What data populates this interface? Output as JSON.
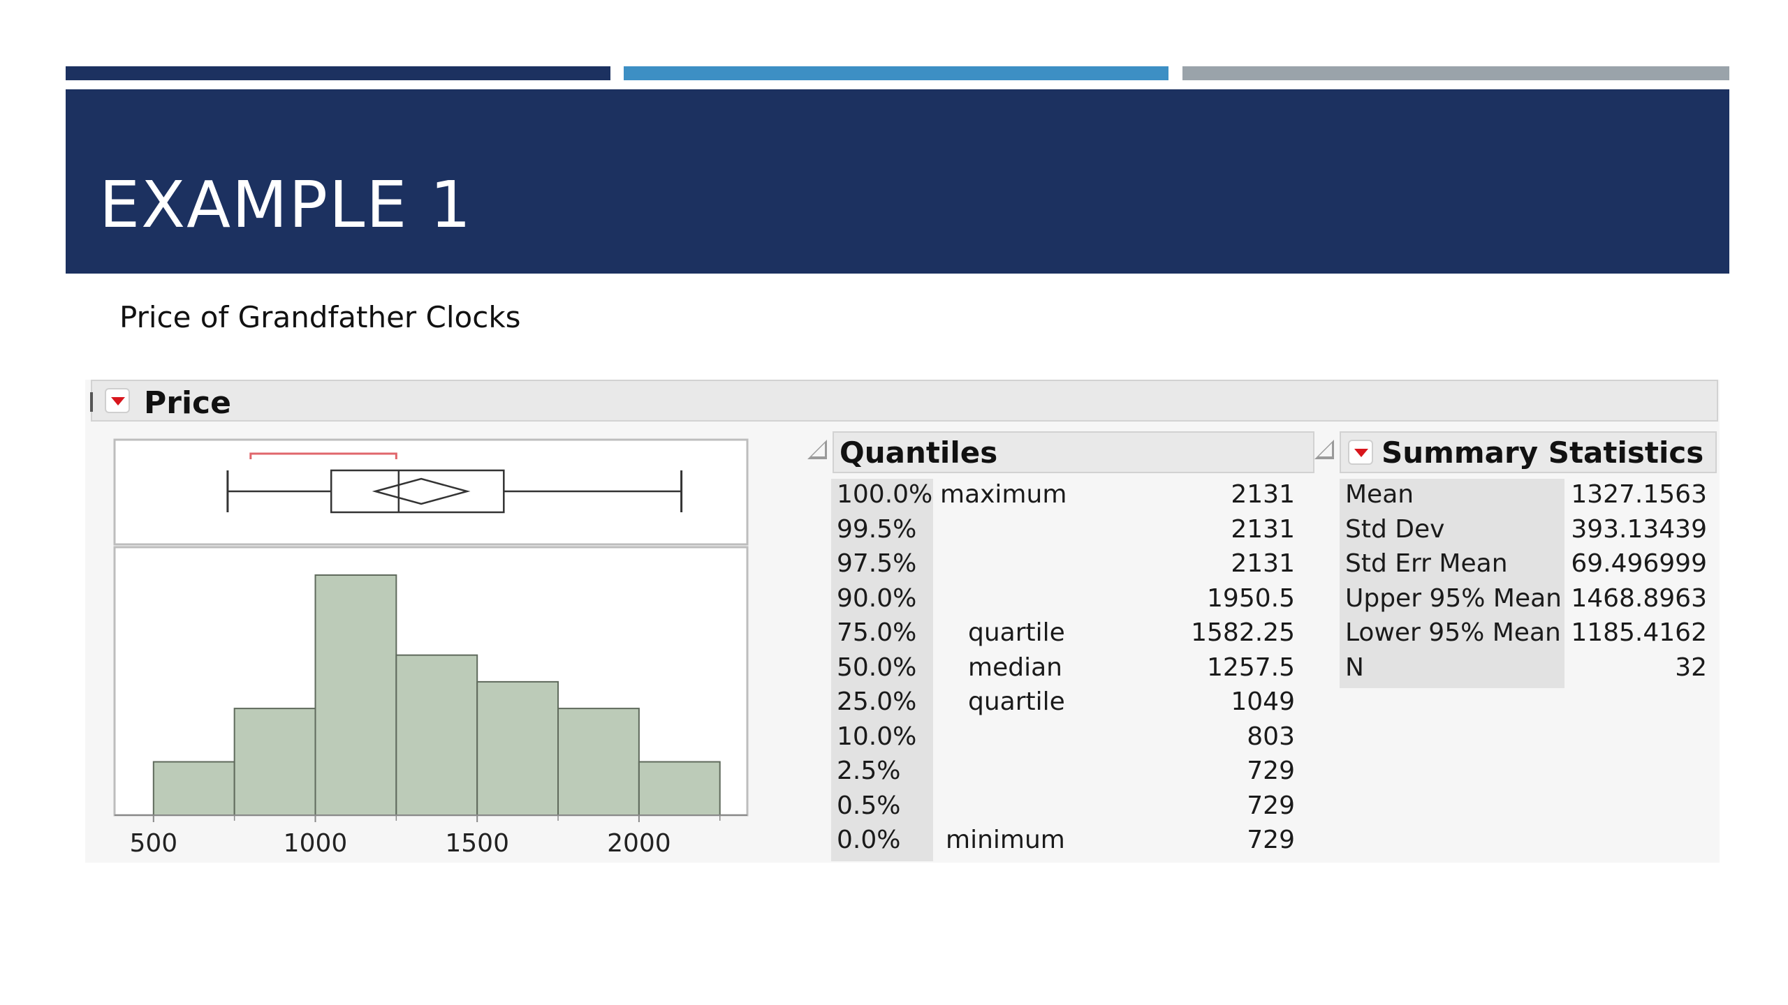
{
  "colors": {
    "bar_dark": "#1c3160",
    "bar_mid": "#3d8fc4",
    "bar_gray": "#9aa3aa",
    "banner": "#1c3160",
    "histogram_fill": "#bccbb8",
    "bracket": "#e0666b"
  },
  "slide": {
    "title": "EXAMPLE 1",
    "subtitle": "Price of Grandfather Clocks"
  },
  "report": {
    "header": "Price",
    "disclosure_icon": "red-triangle-icon"
  },
  "chart_data": {
    "type": "bar",
    "title": "",
    "xlabel": "",
    "ylabel": "",
    "x_ticks": [
      500,
      1000,
      1500,
      2000
    ],
    "bins": [
      {
        "lo": 500,
        "hi": 750,
        "count": 2
      },
      {
        "lo": 750,
        "hi": 1000,
        "count": 4
      },
      {
        "lo": 1000,
        "hi": 1250,
        "count": 9
      },
      {
        "lo": 1250,
        "hi": 1500,
        "count": 6
      },
      {
        "lo": 1500,
        "hi": 1750,
        "count": 5
      },
      {
        "lo": 1750,
        "hi": 2000,
        "count": 4
      },
      {
        "lo": 2000,
        "hi": 2250,
        "count": 2
      }
    ],
    "xlim": [
      440,
      2270
    ],
    "box_plot": {
      "min": 729,
      "q1": 1049,
      "median": 1257.5,
      "q3": 1582.25,
      "max": 2131,
      "mean": 1327.1563,
      "ci_low": 1185.4162,
      "ci_high": 1468.8963,
      "shortest_half": [
        800,
        1250
      ]
    }
  },
  "quantiles": {
    "title": "Quantiles",
    "rows": [
      {
        "pct": "100.0%",
        "label": "maximum",
        "value": "2131"
      },
      {
        "pct": "99.5%",
        "label": "",
        "value": "2131"
      },
      {
        "pct": "97.5%",
        "label": "",
        "value": "2131"
      },
      {
        "pct": "90.0%",
        "label": "",
        "value": "1950.5"
      },
      {
        "pct": "75.0%",
        "label": "quartile",
        "value": "1582.25"
      },
      {
        "pct": "50.0%",
        "label": "median",
        "value": "1257.5"
      },
      {
        "pct": "25.0%",
        "label": "quartile",
        "value": "1049"
      },
      {
        "pct": "10.0%",
        "label": "",
        "value": "803"
      },
      {
        "pct": "2.5%",
        "label": "",
        "value": "729"
      },
      {
        "pct": "0.5%",
        "label": "",
        "value": "729"
      },
      {
        "pct": "0.0%",
        "label": "minimum",
        "value": "729"
      }
    ]
  },
  "summary": {
    "title": "Summary Statistics",
    "rows": [
      {
        "name": "Mean",
        "value": "1327.1563"
      },
      {
        "name": "Std Dev",
        "value": "393.13439"
      },
      {
        "name": "Std Err Mean",
        "value": "69.496999"
      },
      {
        "name": "Upper 95% Mean",
        "value": "1468.8963"
      },
      {
        "name": "Lower 95% Mean",
        "value": "1185.4162"
      },
      {
        "name": "N",
        "value": "32"
      }
    ]
  }
}
